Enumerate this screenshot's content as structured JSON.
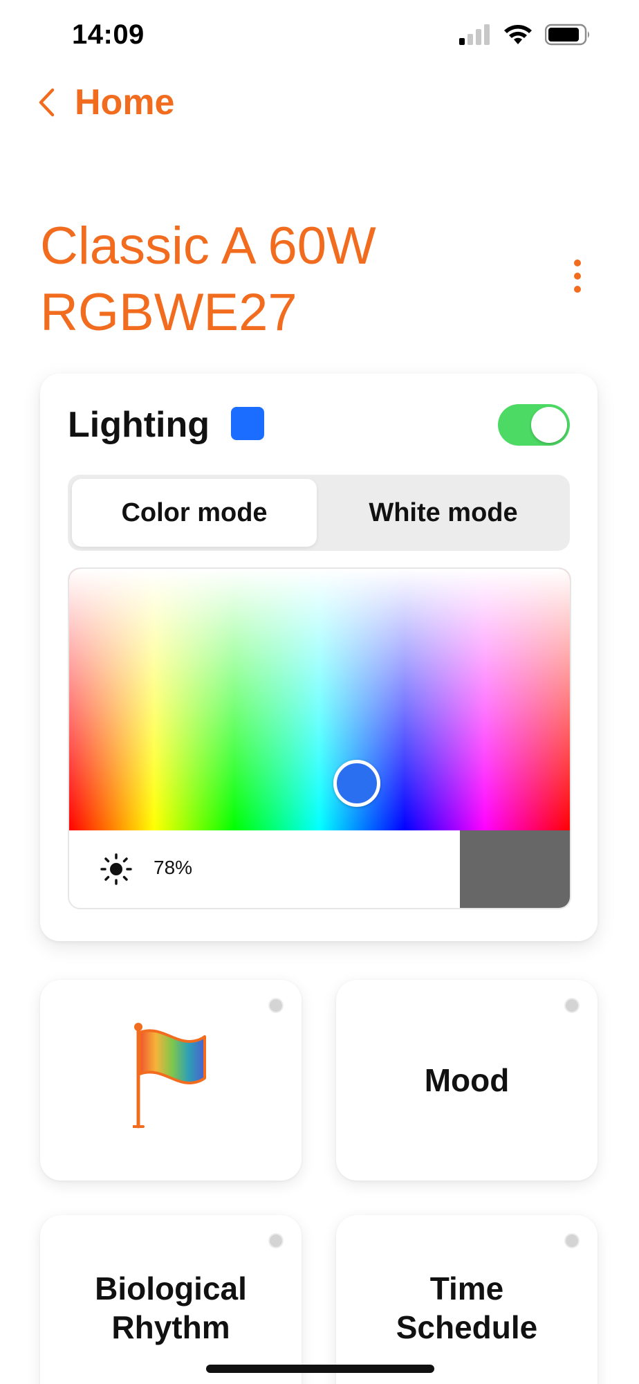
{
  "status_bar": {
    "time": "14:09"
  },
  "nav": {
    "back_label": "Home"
  },
  "device": {
    "title_line1": "Classic A 60W",
    "title_line2": "RGBWE27"
  },
  "lighting": {
    "title": "Lighting",
    "swatch_color": "#1a6dff",
    "power_on": true,
    "toggle_color": "#4cd964",
    "modes": [
      {
        "label": "Color mode",
        "selected": true
      },
      {
        "label": "White mode",
        "selected": false
      }
    ],
    "selected_color": "#2a6fef",
    "brightness_label": "78%",
    "brightness": 0.78
  },
  "tiles": [
    {
      "label": "",
      "icon": "rainbow-flag-icon"
    },
    {
      "label": "Mood"
    },
    {
      "label_line1": "Biological",
      "label_line2": "Rhythm"
    },
    {
      "label_line1": "Time",
      "label_line2": "Schedule"
    }
  ],
  "colors": {
    "accent": "#f26c1f",
    "brightness_fill": "#676767"
  }
}
